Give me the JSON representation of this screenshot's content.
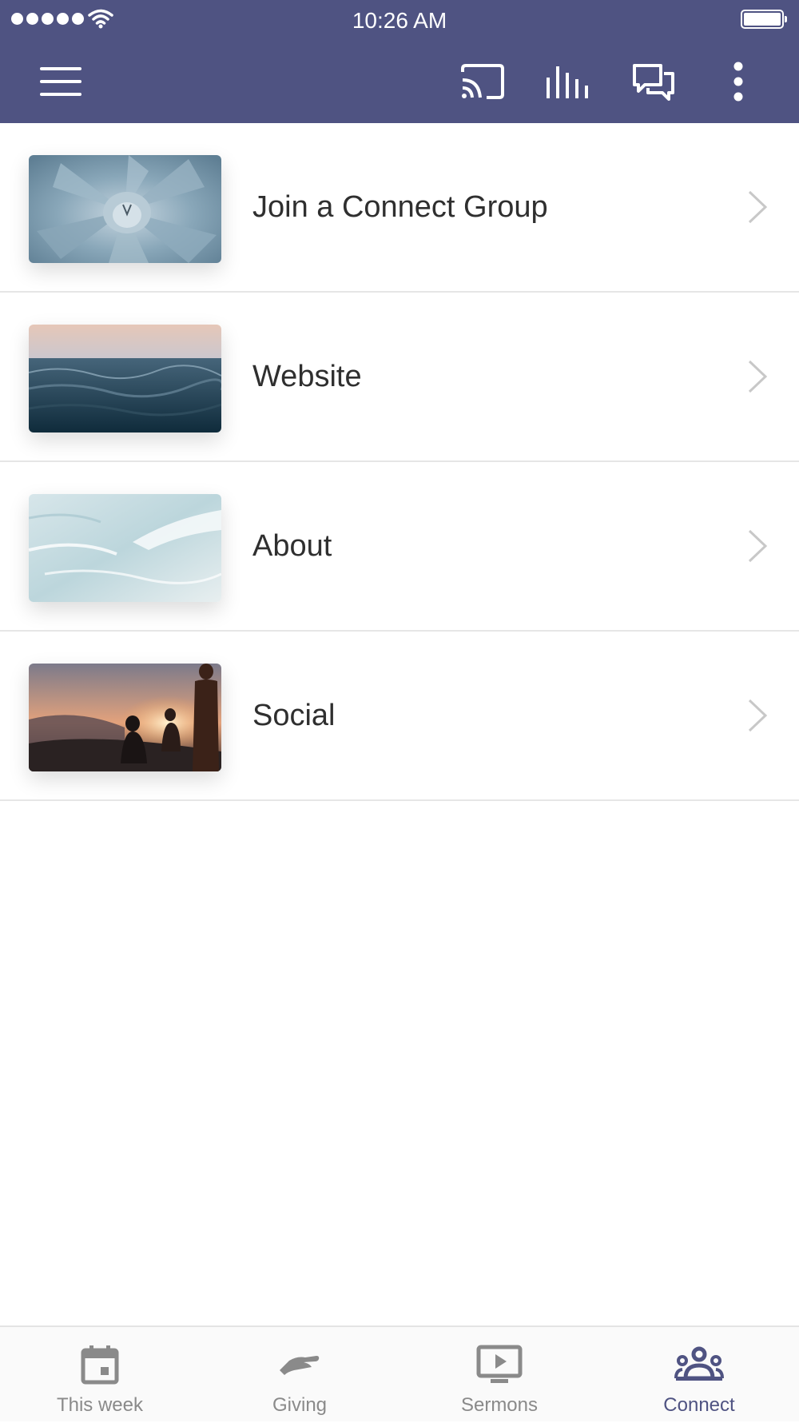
{
  "status_bar": {
    "time": "10:26 AM",
    "signal_icon": "signal-dots",
    "wifi_icon": "wifi-icon",
    "battery_icon": "battery-icon"
  },
  "app_bar": {
    "background_color": "#4f5382",
    "actions": [
      {
        "icon": "menu-icon"
      },
      {
        "icon": "cast-icon"
      },
      {
        "icon": "audio-bars-icon"
      },
      {
        "icon": "chat-icon"
      },
      {
        "icon": "more-vertical-icon"
      }
    ]
  },
  "connect_items": [
    {
      "label": "Join a Connect Group",
      "image": "agave-plant-photo"
    },
    {
      "label": "Website",
      "image": "ocean-waves-photo"
    },
    {
      "label": "About",
      "image": "shallow-water-photo"
    },
    {
      "label": "Social",
      "image": "sunset-people-photo"
    }
  ],
  "tab_bar": {
    "active_color": "#4f5382",
    "inactive_color": "#8a8a8a",
    "tabs": [
      {
        "label": "This week",
        "icon": "calendar-icon",
        "active": false
      },
      {
        "label": "Giving",
        "icon": "giving-hand-icon",
        "active": false
      },
      {
        "label": "Sermons",
        "icon": "play-screen-icon",
        "active": false
      },
      {
        "label": "Connect",
        "icon": "group-icon",
        "active": true
      }
    ]
  }
}
